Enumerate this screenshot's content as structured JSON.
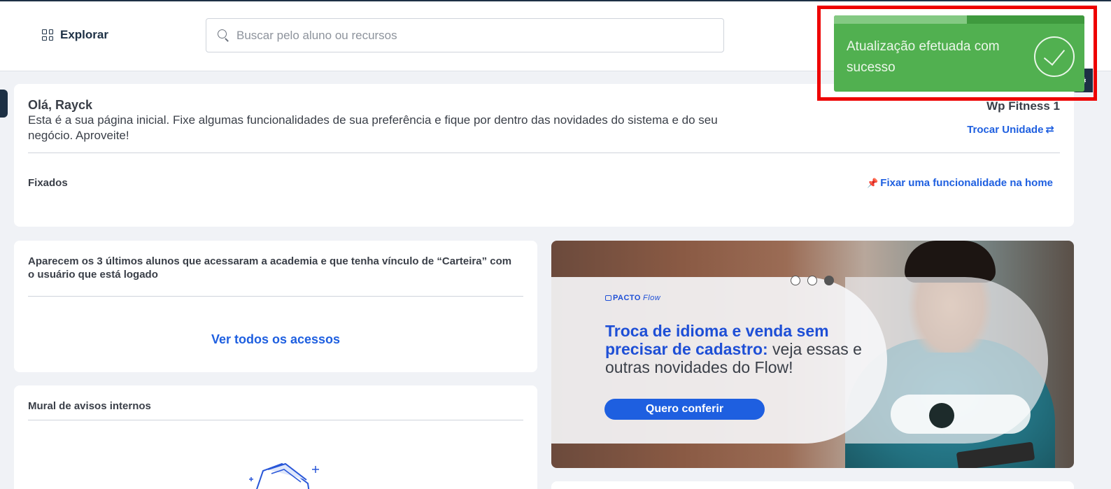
{
  "topbar": {
    "explore_label": "Explorar",
    "search_placeholder": "Buscar pelo aluno ou recursos"
  },
  "toast": {
    "message": "Atualização efetuada com sucesso",
    "progress": 0.53,
    "bg_color": "#51b050",
    "highlight_color": "#ee0000"
  },
  "welcome": {
    "greeting": "Olá, Rayck",
    "text": "Esta é a sua página inicial. Fixe algumas funcionalidades de sua preferência e fique por dentro das novidades do sistema e do seu negócio. Aproveite!",
    "unit_name": "Wp Fitness 1",
    "switch_unit_label": "Trocar Unidade",
    "pinned_title": "Fixados",
    "pin_link_label": "Fixar uma funcionalidade na home"
  },
  "access": {
    "description": "Aparecem os 3 últimos alunos que acessaram a academia e que tenha vínculo de “Carteira” com o usuário que está logado",
    "see_all_label": "Ver todos os acessos"
  },
  "mural": {
    "title": "Mural de avisos internos"
  },
  "banner": {
    "brand": "PACTO",
    "brand_suffix": "Flow",
    "headline_highlight": "Troca de idioma e venda sem precisar de cadastro:",
    "headline_rest": " veja essas e outras novidades do Flow!",
    "cta_label": "Quero conferir",
    "slides": 3,
    "active_slide": 3
  },
  "colors": {
    "accent": "#1e5fe0",
    "navy": "#1d3045",
    "text": "#3a3f48"
  }
}
